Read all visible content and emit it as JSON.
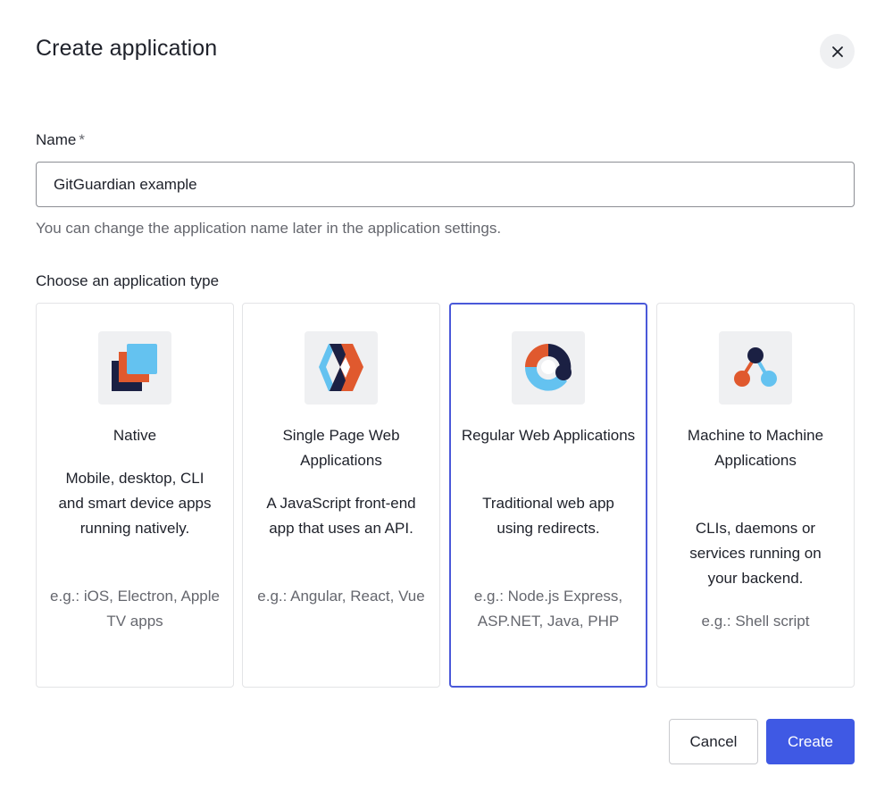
{
  "dialog": {
    "title": "Create application",
    "close_label": "×"
  },
  "name_field": {
    "label": "Name",
    "required_marker": "*",
    "value": "GitGuardian example",
    "help": "You can change the application name later in the application settings."
  },
  "app_type": {
    "label": "Choose an application type",
    "selected": "Regular Web Applications",
    "cards": [
      {
        "icon": "native-app-icon",
        "title": "Native",
        "description": "Mobile, desktop, CLI and smart device apps running natively.",
        "examples": "e.g.: iOS, Electron, Apple TV apps"
      },
      {
        "icon": "single-page-app-icon",
        "title": "Single Page Web Applications",
        "description": "A JavaScript front-end app that uses an API.",
        "examples": "e.g.: Angular, React, Vue"
      },
      {
        "icon": "regular-web-app-icon",
        "title": "Regular Web Applications",
        "description": "Traditional web app using redirects.",
        "examples": "e.g.: Node.js Express, ASP.NET, Java, PHP"
      },
      {
        "icon": "machine-to-machine-icon",
        "title": "Machine to Machine Applications",
        "description": "CLIs, daemons or services running on your backend.",
        "examples": "e.g.: Shell script"
      }
    ]
  },
  "actions": {
    "cancel": "Cancel",
    "create": "Create"
  },
  "colors": {
    "accent": "#3f59e4",
    "selected_border": "#4a59d9",
    "navy": "#1b2043",
    "orange": "#e0592e",
    "light_blue": "#64c2f0"
  }
}
